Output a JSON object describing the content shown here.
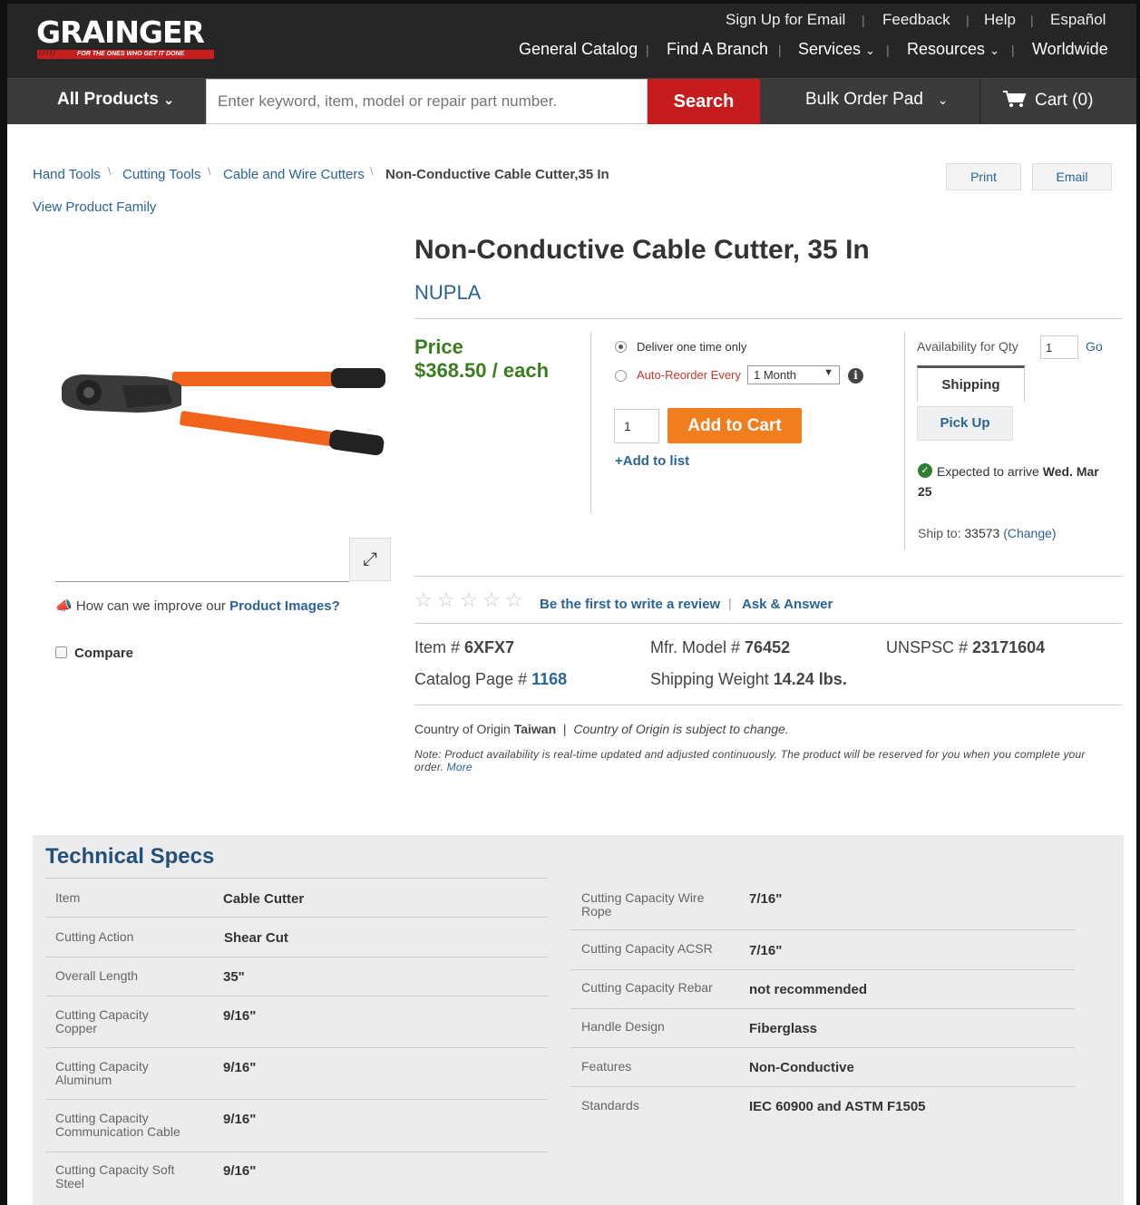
{
  "header": {
    "logo": "GRAINGER",
    "tagline": "FOR THE ONES WHO GET IT DONE",
    "top_links": [
      "Sign Up for Email",
      "Feedback",
      "Help",
      "Español"
    ],
    "nav_links": [
      "General Catalog",
      "Find A Branch",
      "Services",
      "Resources",
      "Worldwide"
    ]
  },
  "search": {
    "all_products": "All Products",
    "placeholder": "Enter keyword, item, model or repair part number.",
    "button": "Search",
    "bulk_order": "Bulk Order Pad",
    "cart": "Cart (0)"
  },
  "breadcrumb": {
    "items": [
      "Hand Tools",
      "Cutting Tools",
      "Cable and Wire Cutters"
    ],
    "current": "Non-Conductive Cable Cutter,35 In",
    "view_family": "View Product Family"
  },
  "actions": {
    "print": "Print",
    "email": "Email"
  },
  "product": {
    "title": "Non-Conductive Cable Cutter, 35 In",
    "brand": "NUPLA",
    "price_label": "Price",
    "price": "$368.50 / each",
    "deliver_once": "Deliver one time only",
    "auto_reorder": "Auto-Reorder Every",
    "reorder_option": "1 Month",
    "qty": "1",
    "add_to_cart": "Add to Cart",
    "add_to_list": "+Add to list",
    "availability_label": "Availability for Qty",
    "availability_qty": "1",
    "go": "Go",
    "tab_shipping": "Shipping",
    "tab_pickup": "Pick Up",
    "expected_text": "Expected to arrive ",
    "expected_date": "Wed. Mar",
    "expected_day": "25",
    "ship_to_label": "Ship to: ",
    "ship_to_zip": "33573",
    "change": "(Change)",
    "improve_text": "How can we improve our ",
    "improve_link": "Product Images",
    "improve_q": "?",
    "compare": "Compare",
    "review_link": "Be the first to write a review",
    "ask_answer": "Ask & Answer",
    "rating": 0,
    "item_label": "Item # ",
    "item": "6XFX7",
    "mfr_label": "Mfr. Model # ",
    "mfr": "76452",
    "unspsc_label": "UNSPSC # ",
    "unspsc": "23171604",
    "catalog_label": "Catalog Page # ",
    "catalog": "1168",
    "weight_label": "Shipping Weight ",
    "weight": "14.24 lbs.",
    "origin_label": "Country of Origin ",
    "origin": "Taiwan",
    "origin_note": "Country of Origin is subject to change.",
    "note": "Note: Product availability is real-time updated and adjusted continuously. The product will be reserved for you when you complete your order.",
    "note_more": "More"
  },
  "specs": {
    "title": "Technical Specs",
    "left": [
      {
        "label": "Item",
        "value": "Cable Cutter"
      },
      {
        "label": "Cutting Action",
        "value": "Shear Cut"
      },
      {
        "label": "Overall Length",
        "value": "35\""
      },
      {
        "label": "Cutting Capacity Copper",
        "value": "9/16\""
      },
      {
        "label": "Cutting Capacity Aluminum",
        "value": "9/16\""
      },
      {
        "label": "Cutting Capacity Communication Cable",
        "value": "9/16\""
      },
      {
        "label": "Cutting Capacity Soft Steel",
        "value": "9/16\""
      }
    ],
    "right": [
      {
        "label": "Cutting Capacity Wire Rope",
        "value": "7/16\""
      },
      {
        "label": "Cutting Capacity ACSR",
        "value": "7/16\""
      },
      {
        "label": "Cutting Capacity Rebar",
        "value": "not recommended"
      },
      {
        "label": "Handle Design",
        "value": "Fiberglass"
      },
      {
        "label": "Features",
        "value": "Non-Conductive"
      },
      {
        "label": "Standards",
        "value": "IEC 60900 and ASTM F1505"
      }
    ]
  },
  "colors": {
    "brand_red": "#c51d1d",
    "cart_orange": "#f07d1e",
    "price_green": "#3a7d1e",
    "link_blue": "#2a6496"
  }
}
